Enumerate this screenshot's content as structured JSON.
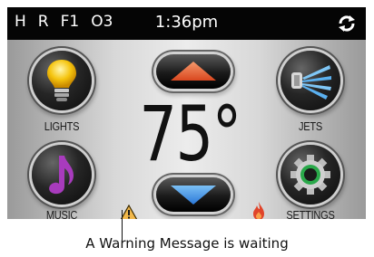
{
  "status_bar": {
    "indicators": [
      "H",
      "R",
      "F1",
      "O3"
    ],
    "time": "1:36pm",
    "sync_icon": "sync-icon"
  },
  "controls": {
    "lights_label": "LIGHTS",
    "jets_label": "JETS",
    "music_label": "MUSIC",
    "settings_label": "SETTINGS",
    "temperature": "75°"
  },
  "icons": {
    "lights": "lightbulb-icon",
    "jets": "jets-icon",
    "music": "music-note-icon",
    "settings": "gear-icon",
    "up": "up-arrow-icon",
    "down": "down-arrow-icon",
    "warning": "warning-icon",
    "heater": "flame-icon"
  },
  "colors": {
    "up_arrow": "#e8603a",
    "down_arrow": "#3a8fe8",
    "warning": "#f2b84a",
    "flame": "#e0442a",
    "music_note": "#a83bbd"
  },
  "annotation": {
    "caption": "A Warning Message is waiting"
  }
}
